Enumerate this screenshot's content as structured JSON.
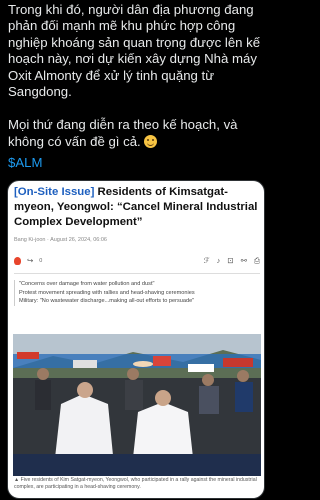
{
  "post": {
    "paragraph1": "Trong khi đó, người dân địa phương đang phản đối mạnh mẽ khu phức hợp công nghiệp khoáng sản quan trọng được lên kế hoạch này, nơi dự kiến xây dựng Nhà máy Oxit Almonty để xử lý tinh quặng từ Sangdong.",
    "paragraph2": "Mọi thứ đang diễn ra theo kế hoạch, và không có vấn đề gì cả.",
    "emoji": "grinning-face-emoji",
    "cashtag": "$ALM",
    "link_color": "#1d9bf0"
  },
  "card": {
    "title_tag": "[On-Site Issue]",
    "title_text": " Residents of Kimsatgat-myeon, Yeongwol: “Cancel Mineral Industrial Complex Development”",
    "meta": "Bang Ki-joon · August 26, 2024, 06:06",
    "reaction_count": "0",
    "toolbar_icons": [
      "fire-icon",
      "share-icon",
      "font-size-icon",
      "listen-icon",
      "bookmark-icon",
      "copy-link-icon",
      "print-icon"
    ],
    "quotes": [
      "\"Concerns over damage from water pollution and dust\"",
      "Protest movement spreading with rallies and head-shaving ceremonies",
      "Military: \"No wastewater discharge...making all-out efforts to persuade\""
    ],
    "caption": "▲ Five residents of Kim Satgat-myeon, Yeongwol, who participated in a rally against the mineral industrial complex, are participating in a head-shaving ceremony.",
    "tag_color": "#1d5fbf"
  }
}
